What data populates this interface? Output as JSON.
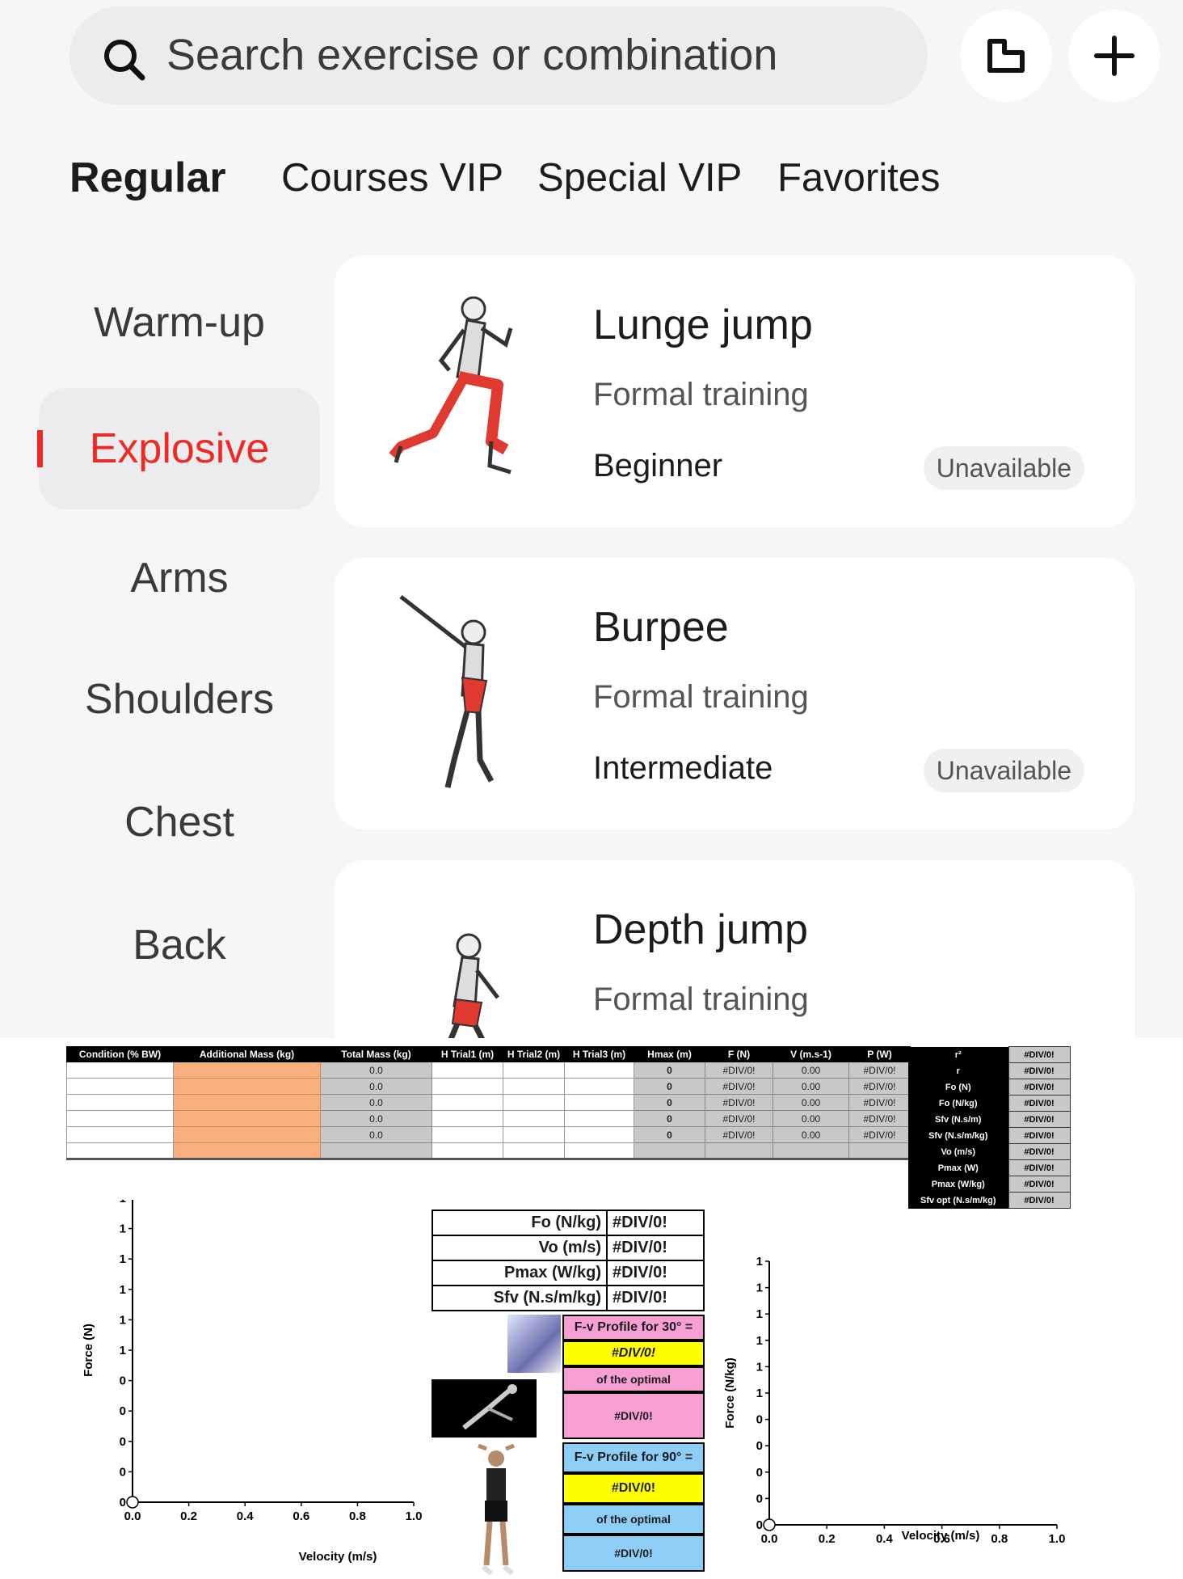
{
  "search": {
    "placeholder": "Search exercise or combination"
  },
  "tabs": [
    {
      "label": "Regular",
      "active": true
    },
    {
      "label": "Courses  VIP",
      "active": false
    },
    {
      "label": "Special VIP",
      "active": false
    },
    {
      "label": "Favorites",
      "active": false
    }
  ],
  "categories": [
    {
      "label": "Warm-up"
    },
    {
      "label": "Explosive",
      "active": true
    },
    {
      "label": "Arms"
    },
    {
      "label": "Shoulders"
    },
    {
      "label": "Chest"
    },
    {
      "label": "Back"
    }
  ],
  "exercises": [
    {
      "title": "Lunge jump",
      "type": "Formal training",
      "level": "Beginner",
      "status": "Unavailable"
    },
    {
      "title": "Burpee",
      "type": "Formal training",
      "level": "Intermediate",
      "status": "Unavailable"
    },
    {
      "title": "Depth jump",
      "type": "Formal training"
    }
  ],
  "colors": {
    "accent": "#ef2a24",
    "orange_cell": "#f9b07e",
    "grey_cell": "#c8c8c8",
    "pink": "#f59fd2",
    "yellow": "#ffff00",
    "blue": "#8ecdf5"
  },
  "sheet": {
    "headers": [
      "Condition (% BW)",
      "Additional Mass (kg)",
      "Total Mass (kg)",
      "H Trial1 (m)",
      "H Trial2 (m)",
      "H Trial3 (m)",
      "Hmax (m)",
      "F (N)",
      "V (m.s-1)",
      "P (W)"
    ],
    "rows": [
      [
        "",
        "",
        "0.0",
        "",
        "",
        "",
        "0",
        "#DIV/0!",
        "0.00",
        "#DIV/0!"
      ],
      [
        "",
        "",
        "0.0",
        "",
        "",
        "",
        "0",
        "#DIV/0!",
        "0.00",
        "#DIV/0!"
      ],
      [
        "",
        "",
        "0.0",
        "",
        "",
        "",
        "0",
        "#DIV/0!",
        "0.00",
        "#DIV/0!"
      ],
      [
        "",
        "",
        "0.0",
        "",
        "",
        "",
        "0",
        "#DIV/0!",
        "0.00",
        "#DIV/0!"
      ],
      [
        "",
        "",
        "0.0",
        "",
        "",
        "",
        "0",
        "#DIV/0!",
        "0.00",
        "#DIV/0!"
      ],
      [
        "",
        "",
        "",
        "",
        "",
        "",
        "",
        "",
        "",
        ""
      ]
    ],
    "stats": [
      {
        "k": "r²",
        "v": "#DIV/0!"
      },
      {
        "k": "r",
        "v": "#DIV/0!"
      },
      {
        "k": "Fo (N)",
        "v": "#DIV/0!"
      },
      {
        "k": "Fo (N/kg)",
        "v": "#DIV/0!"
      },
      {
        "k": "Sfv (N.s/m)",
        "v": "#DIV/0!"
      },
      {
        "k": "Sfv (N.s/m/kg)",
        "v": "#DIV/0!"
      },
      {
        "k": "Vo (m/s)",
        "v": "#DIV/0!"
      },
      {
        "k": "Pmax (W)",
        "v": "#DIV/0!"
      },
      {
        "k": "Pmax (W/kg)",
        "v": "#DIV/0!"
      },
      {
        "k": "Sfv opt (N.s/m/kg)",
        "v": "#DIV/0!"
      }
    ],
    "summary": [
      {
        "k": "Fo (N/kg)",
        "v": "#DIV/0!"
      },
      {
        "k": "Vo (m/s)",
        "v": "#DIV/0!"
      },
      {
        "k": "Pmax (W/kg)",
        "v": "#DIV/0!"
      },
      {
        "k": "Sfv (N.s/m/kg)",
        "v": "#DIV/0!"
      }
    ],
    "profile30": {
      "title": "F-v Profile for 30° =",
      "value": "#DIV/0!",
      "of_optimal": "of the optimal",
      "pct": "#DIV/0!"
    },
    "profile90": {
      "title": "F-v Profile for 90° =",
      "value": "#DIV/0!",
      "of_optimal": "of the optimal",
      "pct": "#DIV/0!"
    }
  },
  "chart_data": [
    {
      "type": "scatter",
      "title": "",
      "xlabel": "Velocity (m/s)",
      "ylabel": "Force (N)",
      "x_ticks": [
        "0.0",
        "0.2",
        "0.4",
        "0.6",
        "0.8",
        "1.0"
      ],
      "y_ticks": [
        "0",
        "0",
        "0",
        "0",
        "0",
        "1",
        "1",
        "1",
        "1",
        "1",
        "1"
      ],
      "xlim": [
        0,
        1
      ],
      "series": [
        {
          "x": [
            0
          ],
          "y": [
            0
          ]
        }
      ]
    },
    {
      "type": "scatter",
      "title": "",
      "xlabel": "Velocity (m/s)",
      "ylabel": "Force (N/kg)",
      "x_ticks": [
        "0.0",
        "0.2",
        "0.4",
        "0.6",
        "0.8",
        "1.0"
      ],
      "y_ticks": [
        "0",
        "0",
        "0",
        "0",
        "0",
        "1",
        "1",
        "1",
        "1",
        "1",
        "1"
      ],
      "xlim": [
        0,
        1
      ],
      "series": [
        {
          "x": [
            0
          ],
          "y": [
            0
          ]
        }
      ]
    }
  ]
}
